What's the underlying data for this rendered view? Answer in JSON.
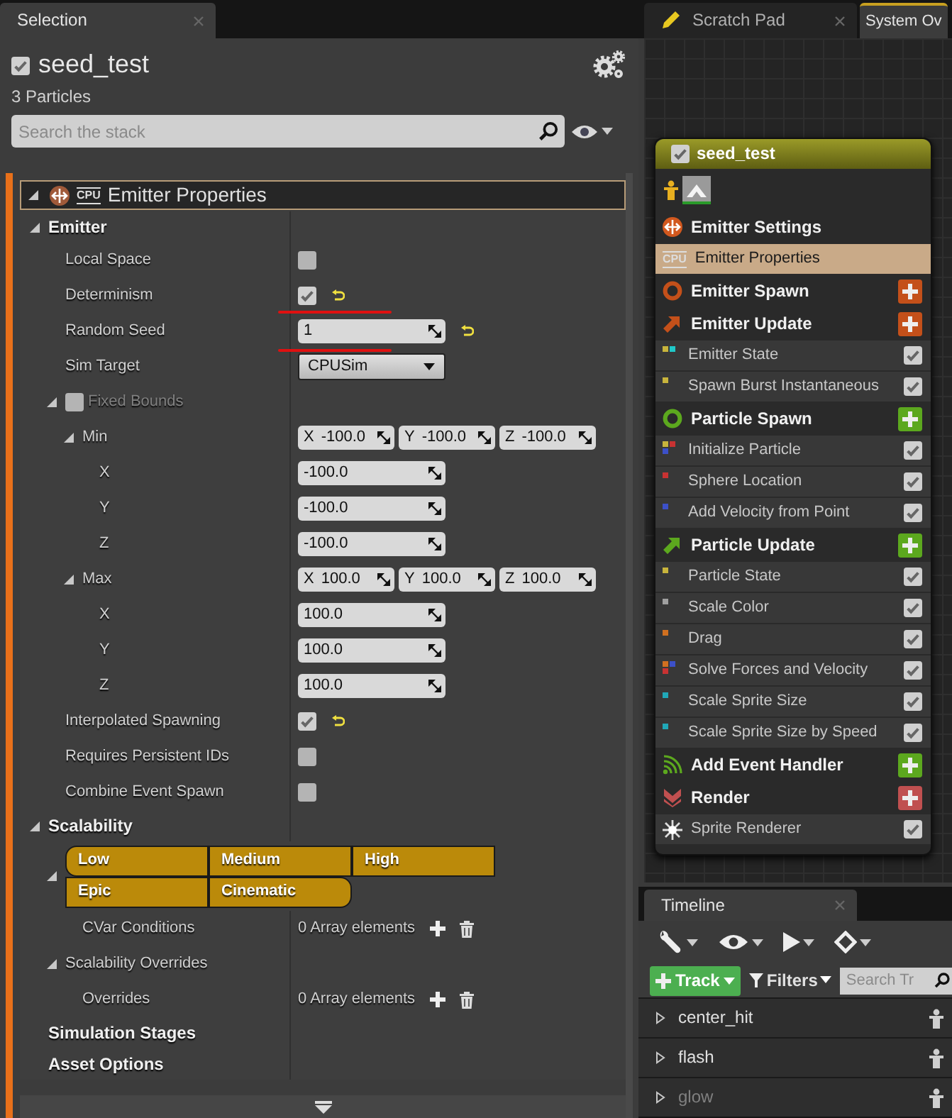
{
  "left_tabs": [
    {
      "label": "Selection",
      "selected": true,
      "closable": true
    }
  ],
  "emitter": {
    "enabled": true,
    "name": "seed_test",
    "particles": "3 Particles"
  },
  "stack_search": {
    "placeholder": "Search the stack"
  },
  "stack": {
    "title": "Emitter Properties",
    "badge": "CPU",
    "expanded": true,
    "rows": [
      {
        "kind": "section",
        "label": "Emitter",
        "expanded": true,
        "children": [
          {
            "kind": "check",
            "label": "Local Space",
            "checked": false
          },
          {
            "kind": "check",
            "label": "Determinism",
            "checked": true,
            "reset": true,
            "underlined": true
          },
          {
            "kind": "number",
            "label": "Random Seed",
            "value": "1",
            "reset": true,
            "underlined": true
          },
          {
            "kind": "dropdown",
            "label": "Sim Target",
            "value": "CPUSim"
          },
          {
            "kind": "group",
            "label": "Fixed Bounds",
            "checked": false,
            "disabled": true,
            "expanded": true,
            "children": [
              {
                "kind": "vector",
                "label": "Min",
                "expanded": true,
                "components": [
                  {
                    "axis": "X",
                    "value": "-100.0"
                  },
                  {
                    "axis": "Y",
                    "value": "-100.0"
                  },
                  {
                    "axis": "Z",
                    "value": "-100.0"
                  }
                ],
                "children": [
                  {
                    "kind": "number",
                    "label": "X",
                    "value": "-100.0"
                  },
                  {
                    "kind": "number",
                    "label": "Y",
                    "value": "-100.0"
                  },
                  {
                    "kind": "number",
                    "label": "Z",
                    "value": "-100.0"
                  }
                ]
              },
              {
                "kind": "vector",
                "label": "Max",
                "expanded": true,
                "components": [
                  {
                    "axis": "X",
                    "value": "100.0"
                  },
                  {
                    "axis": "Y",
                    "value": "100.0"
                  },
                  {
                    "axis": "Z",
                    "value": "100.0"
                  }
                ],
                "children": [
                  {
                    "kind": "number",
                    "label": "X",
                    "value": "100.0"
                  },
                  {
                    "kind": "number",
                    "label": "Y",
                    "value": "100.0"
                  },
                  {
                    "kind": "number",
                    "label": "Z",
                    "value": "100.0"
                  }
                ]
              }
            ]
          },
          {
            "kind": "check",
            "label": "Interpolated Spawning",
            "checked": true,
            "reset": true
          },
          {
            "kind": "check",
            "label": "Requires Persistent IDs",
            "checked": false
          },
          {
            "kind": "check",
            "label": "Combine Event Spawn",
            "checked": false
          }
        ]
      },
      {
        "kind": "section",
        "label": "Scalability",
        "expanded": true,
        "children": [
          {
            "kind": "platforms",
            "expanded": true,
            "levels": [
              {
                "label": "Low",
                "selected": true
              },
              {
                "label": "Medium",
                "selected": true
              },
              {
                "label": "High",
                "selected": true
              },
              {
                "label": "Epic",
                "selected": true
              },
              {
                "label": "Cinematic",
                "selected": true
              }
            ],
            "children": [
              {
                "kind": "array",
                "label": "CVar Conditions",
                "value": "0 Array elements"
              }
            ]
          },
          {
            "kind": "subsection",
            "label": "Scalability Overrides",
            "expanded": true,
            "children": [
              {
                "kind": "array",
                "label": "Overrides",
                "value": "0 Array elements"
              }
            ]
          }
        ]
      },
      {
        "kind": "section",
        "label": "Simulation Stages"
      },
      {
        "kind": "section",
        "label": "Asset Options"
      }
    ]
  },
  "right_tabs": [
    {
      "kind": "scratch",
      "label": "Scratch Pad",
      "selected": false,
      "closable": true
    },
    {
      "kind": "plain",
      "label": "System Ov",
      "selected": true
    }
  ],
  "node": {
    "enabled": true,
    "name": "seed_test",
    "items": [
      {
        "kind": "settings",
        "label": "Emitter Settings",
        "color": "#d2581e"
      },
      {
        "kind": "properties",
        "label": "Emitter Properties",
        "badge": "CPU",
        "selected": true
      },
      {
        "kind": "spawn",
        "label": "Emitter Spawn",
        "color": "#c4501a",
        "add": true
      },
      {
        "kind": "update",
        "label": "Emitter Update",
        "color": "#c4501a",
        "add": true
      },
      {
        "kind": "module",
        "label": "Emitter State",
        "selected": false,
        "enabled": true,
        "dots": [
          {
            "color": "#c8b43c"
          },
          {
            "color": "#20c8c8"
          }
        ]
      },
      {
        "kind": "module",
        "label": "Spawn Burst Instantaneous",
        "selected": false,
        "enabled": true,
        "dots": [
          {
            "color": "#c8b43c"
          }
        ]
      },
      {
        "kind": "spawn",
        "label": "Particle Spawn",
        "color": "#5ca81e",
        "add": true
      },
      {
        "kind": "module",
        "label": "Initialize Particle",
        "selected": false,
        "enabled": true,
        "dots": [
          {
            "color": "#c8b43c"
          },
          {
            "color": "#c83232"
          },
          {
            "color": "#3c50c8"
          }
        ]
      },
      {
        "kind": "module",
        "label": "Sphere Location",
        "selected": false,
        "enabled": true,
        "dots": [
          {
            "color": "#c83232"
          }
        ]
      },
      {
        "kind": "module",
        "label": "Add Velocity from Point",
        "selected": false,
        "enabled": true,
        "dots": [
          {
            "color": "#3c50c8"
          }
        ]
      },
      {
        "kind": "update",
        "label": "Particle Update",
        "color": "#5ca81e",
        "add": true
      },
      {
        "kind": "module",
        "label": "Particle State",
        "selected": false,
        "enabled": true,
        "dots": [
          {
            "color": "#c8b43c"
          }
        ]
      },
      {
        "kind": "module",
        "label": "Scale Color",
        "selected": false,
        "enabled": true,
        "dots": [
          {
            "color": "#a0a0a0"
          }
        ]
      },
      {
        "kind": "module",
        "label": "Drag",
        "selected": false,
        "enabled": true,
        "dots": [
          {
            "color": "#d07020"
          }
        ]
      },
      {
        "kind": "module",
        "label": "Solve Forces and Velocity",
        "selected": false,
        "enabled": true,
        "dots": [
          {
            "color": "#d07020"
          },
          {
            "color": "#3c50c8"
          },
          {
            "color": "#c83232"
          }
        ]
      },
      {
        "kind": "module",
        "label": "Scale Sprite Size",
        "selected": false,
        "enabled": true,
        "dots": [
          {
            "color": "#20a8b8"
          }
        ]
      },
      {
        "kind": "module",
        "label": "Scale Sprite Size by Speed",
        "selected": false,
        "enabled": true,
        "dots": [
          {
            "color": "#20a8b8"
          }
        ]
      },
      {
        "kind": "events",
        "label": "Add Event Handler",
        "color": "#5ca81e",
        "add": true
      },
      {
        "kind": "render",
        "label": "Render",
        "color": "#c05050",
        "add": true
      },
      {
        "kind": "renderer",
        "label": "Sprite Renderer",
        "selected": false,
        "enabled": true
      }
    ]
  },
  "timeline": {
    "tab": {
      "label": "Timeline",
      "selected": true,
      "closable": true
    },
    "track_button": "Track",
    "filters": "Filters",
    "search_placeholder": "Search Tr",
    "tracks": [
      {
        "label": "center_hit",
        "enabled": true,
        "expanded": false
      },
      {
        "label": "flash",
        "enabled": true,
        "expanded": false
      },
      {
        "label": "glow",
        "enabled": false,
        "expanded": false
      }
    ]
  }
}
